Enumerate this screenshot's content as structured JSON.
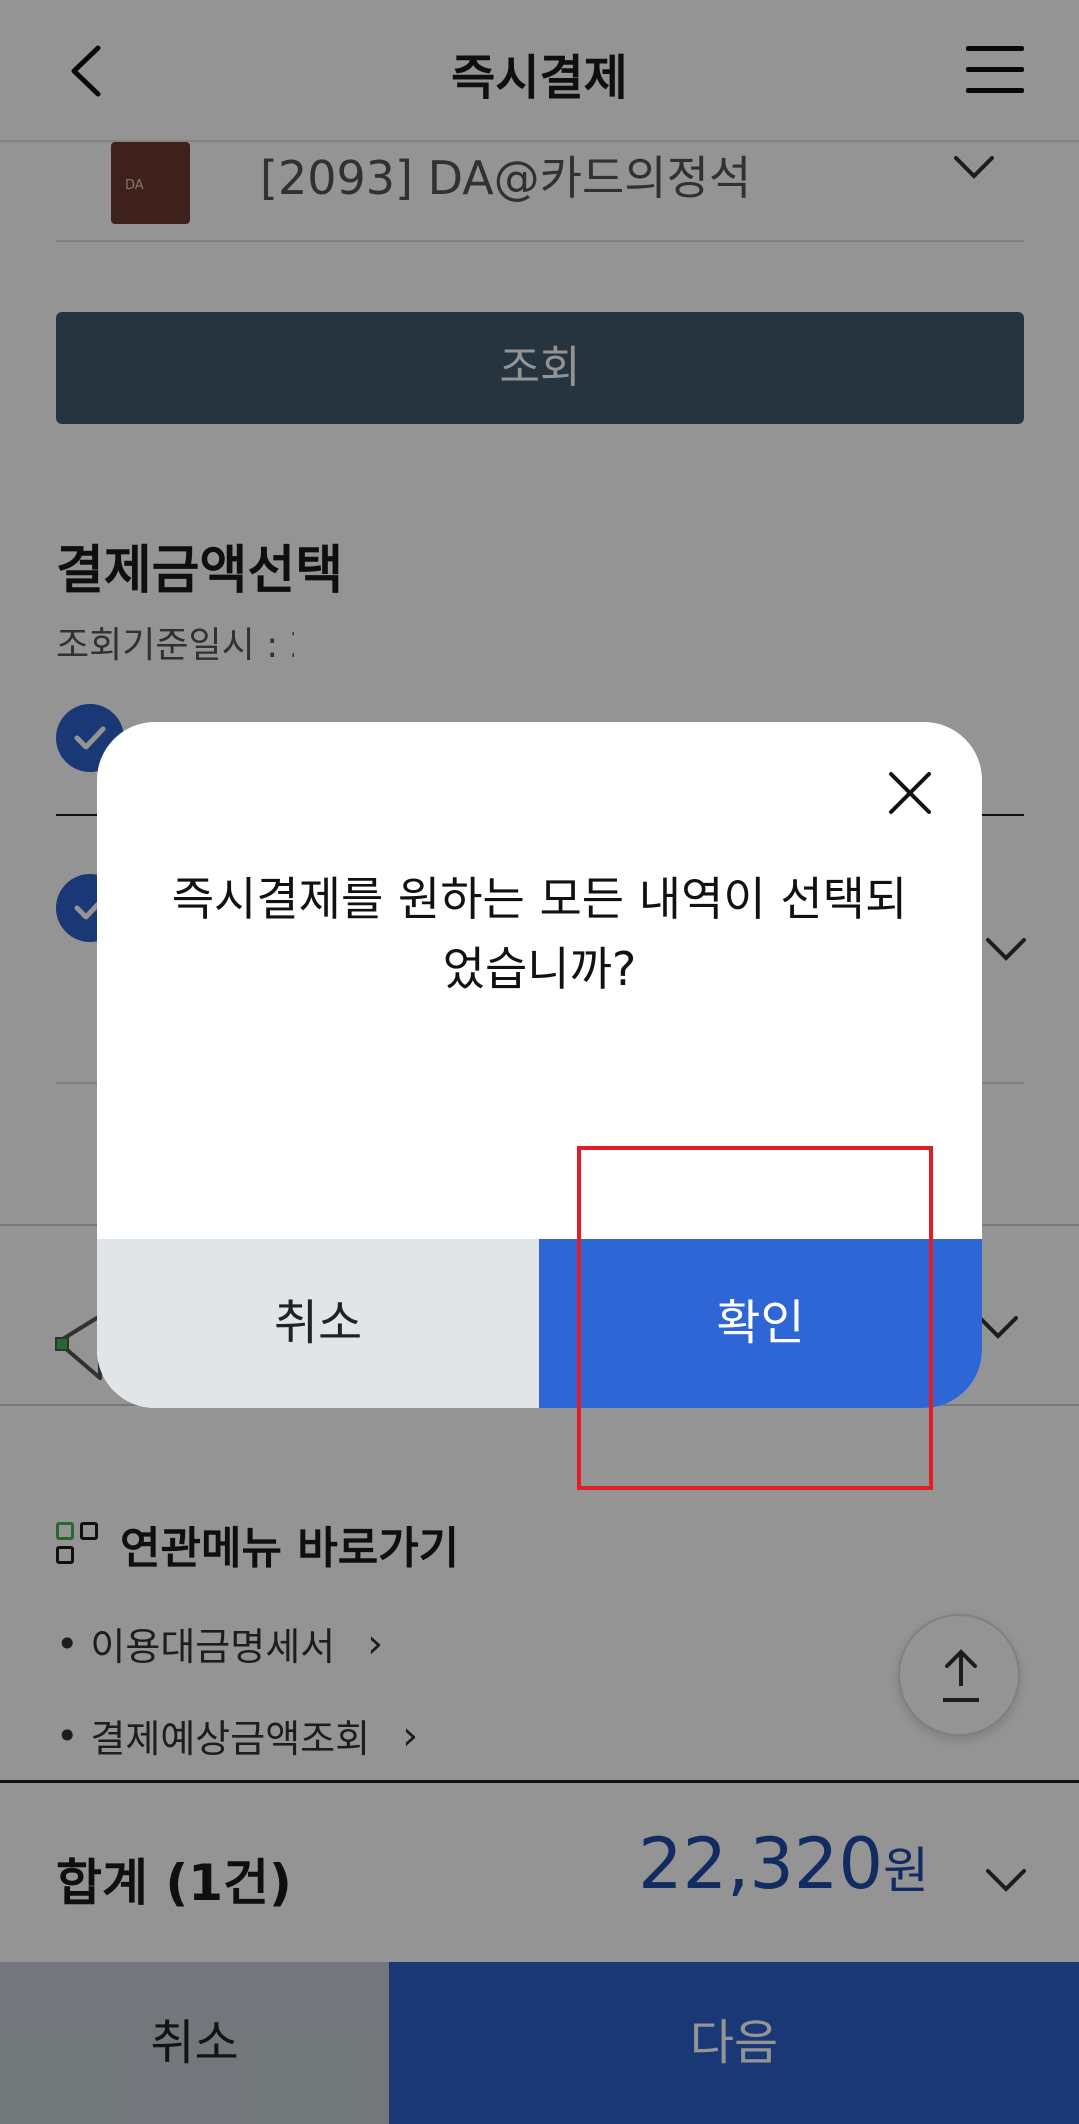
{
  "header": {
    "title": "즉시결제"
  },
  "card": {
    "name": "[2093] DA@카드의정석",
    "thumb_text": "DA"
  },
  "search_button": {
    "label": "조회"
  },
  "payment_select": {
    "title": "결제금액선택",
    "ref_label": "조회기준일시 : 2"
  },
  "related": {
    "title": "연관메뉴 바로가기",
    "links": [
      {
        "label": "이용대금명세서"
      },
      {
        "label": "결제예상금액조회"
      }
    ]
  },
  "total": {
    "label": "합계 (1건)",
    "amount": "22,320",
    "unit": "원"
  },
  "bottom_bar": {
    "cancel_label": "취소",
    "next_label": "다음"
  },
  "dialog": {
    "message_line1": "즉시결제를 원하는 모든 내역이 선택되",
    "message_line2": "었습니까?",
    "cancel_label": "취소",
    "confirm_label": "확인"
  },
  "colors": {
    "primary": "#2e66d6",
    "amount": "#1f4aa8",
    "highlight": "#e01e2a"
  }
}
